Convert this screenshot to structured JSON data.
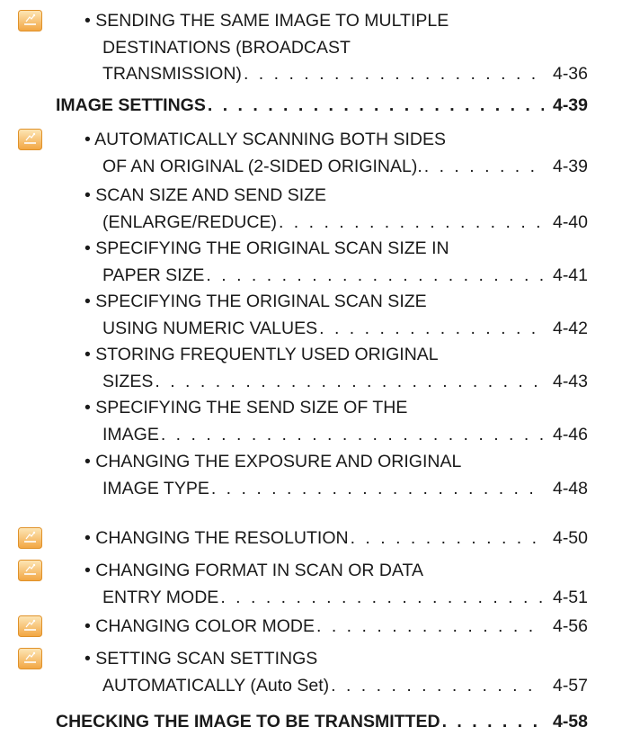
{
  "icon_name": "scanner-mode-icon",
  "colors": {
    "icon_orange": "#f2a541",
    "icon_light": "#fde7b8",
    "text": "#1a1a1a"
  },
  "entries": [
    {
      "kind": "bullet",
      "has_icon": true,
      "lines": [
        "• SENDING THE SAME IMAGE TO MULTIPLE",
        "DESTINATIONS (BROADCAST",
        "TRANSMISSION)"
      ],
      "page": "4-36"
    },
    {
      "kind": "heading",
      "lines": [
        "IMAGE SETTINGS"
      ],
      "page": "4-39"
    },
    {
      "kind": "bullet",
      "has_icon": true,
      "lines": [
        "• AUTOMATICALLY SCANNING BOTH SIDES",
        "OF AN ORIGINAL (2-SIDED ORIGINAL)."
      ],
      "page": "4-39"
    },
    {
      "kind": "bullet",
      "has_icon": false,
      "lines": [
        "• SCAN SIZE AND SEND SIZE",
        "(ENLARGE/REDUCE)"
      ],
      "page": "4-40"
    },
    {
      "kind": "bullet",
      "has_icon": false,
      "lines": [
        "• SPECIFYING THE ORIGINAL SCAN SIZE IN",
        "PAPER SIZE"
      ],
      "page": "4-41"
    },
    {
      "kind": "bullet",
      "has_icon": false,
      "lines": [
        "• SPECIFYING THE ORIGINAL SCAN SIZE",
        "USING NUMERIC VALUES"
      ],
      "page": "4-42"
    },
    {
      "kind": "bullet",
      "has_icon": false,
      "lines": [
        "• STORING FREQUENTLY USED ORIGINAL",
        "SIZES"
      ],
      "page": "4-43"
    },
    {
      "kind": "bullet",
      "has_icon": false,
      "lines": [
        "• SPECIFYING THE SEND SIZE OF THE",
        "IMAGE"
      ],
      "page": "4-46"
    },
    {
      "kind": "bullet",
      "has_icon": false,
      "lines": [
        "• CHANGING THE EXPOSURE AND ORIGINAL",
        "IMAGE TYPE"
      ],
      "page": "4-48"
    },
    {
      "kind": "bullet",
      "has_icon": true,
      "lines": [
        "• CHANGING THE RESOLUTION"
      ],
      "page": "4-50"
    },
    {
      "kind": "bullet",
      "has_icon": true,
      "lines": [
        "• CHANGING FORMAT IN SCAN OR DATA",
        "ENTRY MODE"
      ],
      "page": "4-51"
    },
    {
      "kind": "bullet",
      "has_icon": true,
      "lines": [
        "• CHANGING COLOR MODE"
      ],
      "page": "4-56"
    },
    {
      "kind": "bullet",
      "has_icon": true,
      "lines": [
        "• SETTING SCAN SETTINGS",
        "AUTOMATICALLY (Auto Set)"
      ],
      "page": "4-57"
    },
    {
      "kind": "heading",
      "lines": [
        "CHECKING THE IMAGE TO BE TRANSMITTED"
      ],
      "page": "4-58"
    }
  ]
}
